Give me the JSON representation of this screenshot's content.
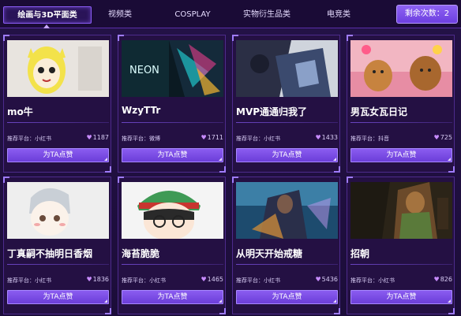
{
  "tabs": [
    {
      "label": "绘画与3D平面类",
      "active": true
    },
    {
      "label": "视频类",
      "active": false
    },
    {
      "label": "COSPLAY",
      "active": false
    },
    {
      "label": "实物衍生品类",
      "active": false
    },
    {
      "label": "电竞类",
      "active": false
    }
  ],
  "remaining": {
    "label": "剩余次数：2"
  },
  "cards": [
    {
      "name": "mo牛",
      "platform": "推荐平台：小红书",
      "likes": "1187",
      "vote": "为TA点赞",
      "thumb_text": ""
    },
    {
      "name": "WzyTTr",
      "platform": "推荐平台：微博",
      "likes": "1711",
      "vote": "为TA点赞",
      "thumb_text": "NEON"
    },
    {
      "name": "MVP通通归我了",
      "platform": "推荐平台：小红书",
      "likes": "1433",
      "vote": "为TA点赞",
      "thumb_text": ""
    },
    {
      "name": "男瓦女瓦日记",
      "platform": "推荐平台：抖音",
      "likes": "725",
      "vote": "为TA点赞",
      "thumb_text": ""
    },
    {
      "name": "丁真嗣不抽明日香烟",
      "platform": "推荐平台：小红书",
      "likes": "1836",
      "vote": "为TA点赞",
      "thumb_text": ""
    },
    {
      "name": "海苔脆脆",
      "platform": "推荐平台：小红书",
      "likes": "1465",
      "vote": "为TA点赞",
      "thumb_text": ""
    },
    {
      "name": "从明天开始戒糖",
      "platform": "推荐平台：小红书",
      "likes": "5436",
      "vote": "为TA点赞",
      "thumb_text": ""
    },
    {
      "name": "招朝",
      "platform": "推荐平台：小红书",
      "likes": "826",
      "vote": "为TA点赞",
      "thumb_text": ""
    }
  ],
  "colors": {
    "accent": "#8a5cf0",
    "background": "#1e0f3c",
    "heart": "#c88cff"
  }
}
